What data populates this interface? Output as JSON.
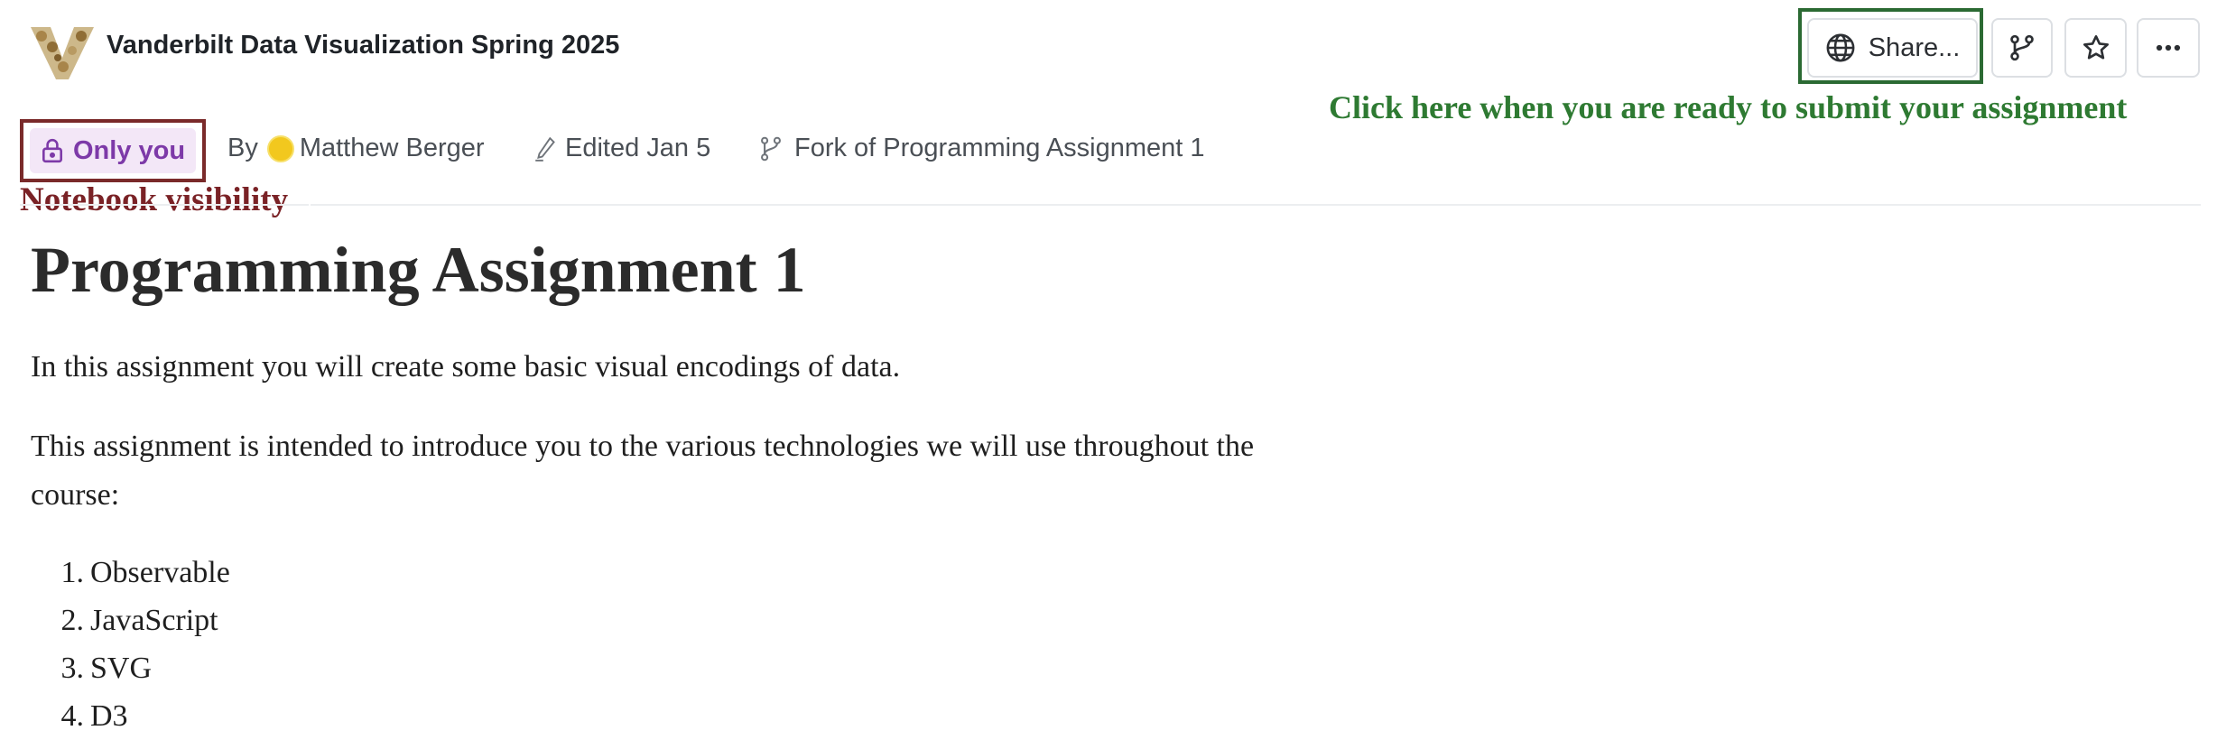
{
  "header": {
    "workspace_title": "Vanderbilt Data Visualization Spring 2025",
    "logo_icon": "vanderbilt-v-logo",
    "share_label": "Share...",
    "share_icon": "globe-icon",
    "fork_icon": "fork-icon",
    "star_icon": "star-icon",
    "more_icon": "more-horizontal-icon"
  },
  "annotations": {
    "submit": "Click here when you are ready to submit your assignment",
    "visibility": "Notebook visibility",
    "submit_color": "#2e7a32",
    "visibility_color": "#7a2226"
  },
  "meta": {
    "visibility_label": "Only you",
    "visibility_icon": "lock-icon",
    "by_prefix": "By",
    "author": "Matthew Berger",
    "edited": "Edited Jan 5",
    "edited_icon": "pencil-icon",
    "fork_of": "Fork of Programming Assignment 1",
    "fork_icon": "fork-icon"
  },
  "notebook": {
    "title": "Programming Assignment 1",
    "paragraph1": "In this assignment you will create some basic visual encodings of data.",
    "paragraph2": "This assignment is intended to introduce you to the various technologies we will use throughout the course:",
    "list": [
      {
        "num": "1.",
        "text": "Observable"
      },
      {
        "num": "2.",
        "text": "JavaScript"
      },
      {
        "num": "3.",
        "text": "SVG"
      },
      {
        "num": "4.",
        "text": "D3"
      }
    ]
  }
}
